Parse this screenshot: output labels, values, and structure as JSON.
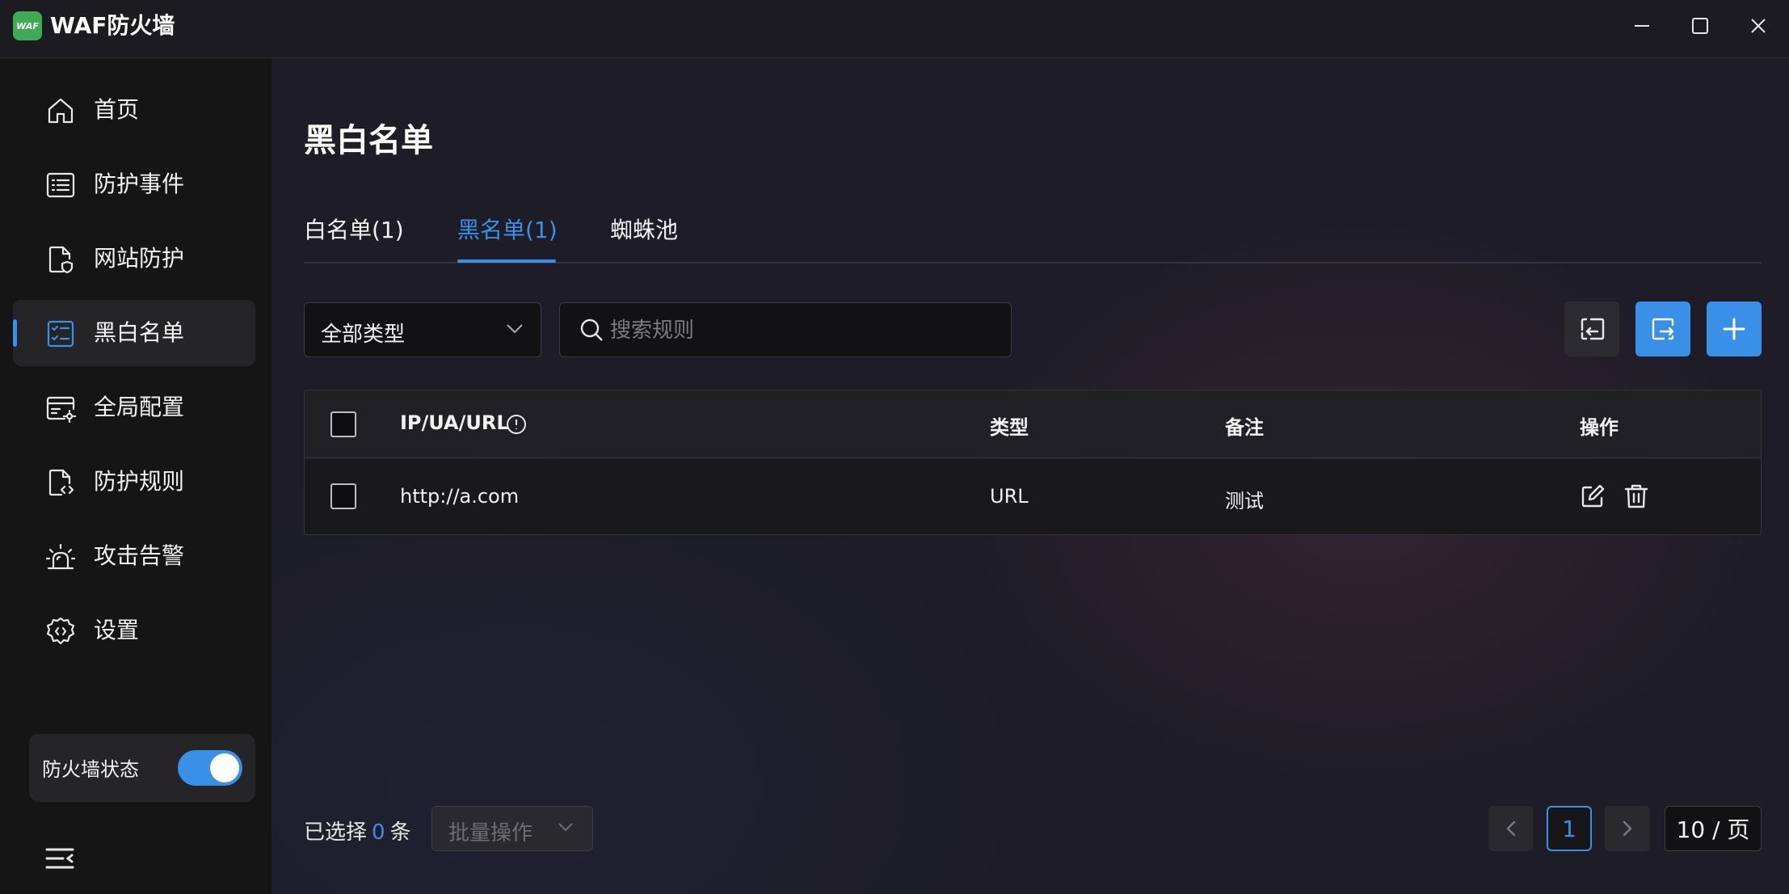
{
  "app": {
    "title": "WAF防火墙",
    "logo_text": "WAF"
  },
  "sidebar": {
    "items": [
      {
        "label": "首页",
        "icon": "home-icon"
      },
      {
        "label": "防护事件",
        "icon": "list-icon"
      },
      {
        "label": "网站防护",
        "icon": "document-shield-icon"
      },
      {
        "label": "黑白名单",
        "icon": "checklist-icon",
        "active": true
      },
      {
        "label": "全局配置",
        "icon": "browser-gear-icon"
      },
      {
        "label": "防护规则",
        "icon": "document-code-icon"
      },
      {
        "label": "攻击告警",
        "icon": "alarm-icon"
      },
      {
        "label": "设置",
        "icon": "gear-code-icon"
      }
    ],
    "firewall_status": {
      "label": "防火墙状态",
      "enabled": true
    }
  },
  "main": {
    "page_title": "黑白名单",
    "tabs": [
      {
        "label": "白名单(1)"
      },
      {
        "label": "黑名单(1)",
        "active": true
      },
      {
        "label": "蜘蛛池"
      }
    ],
    "filter": {
      "type_value": "全部类型"
    },
    "search": {
      "placeholder": "搜索规则",
      "value": ""
    },
    "table": {
      "columns": [
        "IP/UA/URL",
        "类型",
        "备注",
        "操作"
      ],
      "rows": [
        {
          "target": "http://a.com",
          "type": "URL",
          "note": "测试"
        }
      ]
    },
    "footer": {
      "selected_prefix": "已选择",
      "selected_count": "0",
      "selected_suffix": "条",
      "batch_label": "批量操作",
      "current_page": "1",
      "page_size": "10 / 页"
    }
  },
  "colors": {
    "accent": "#3a8fe6",
    "logo": "#3fa956",
    "sidebar_bg": "#151516",
    "main_bg": "#1e1d27"
  }
}
